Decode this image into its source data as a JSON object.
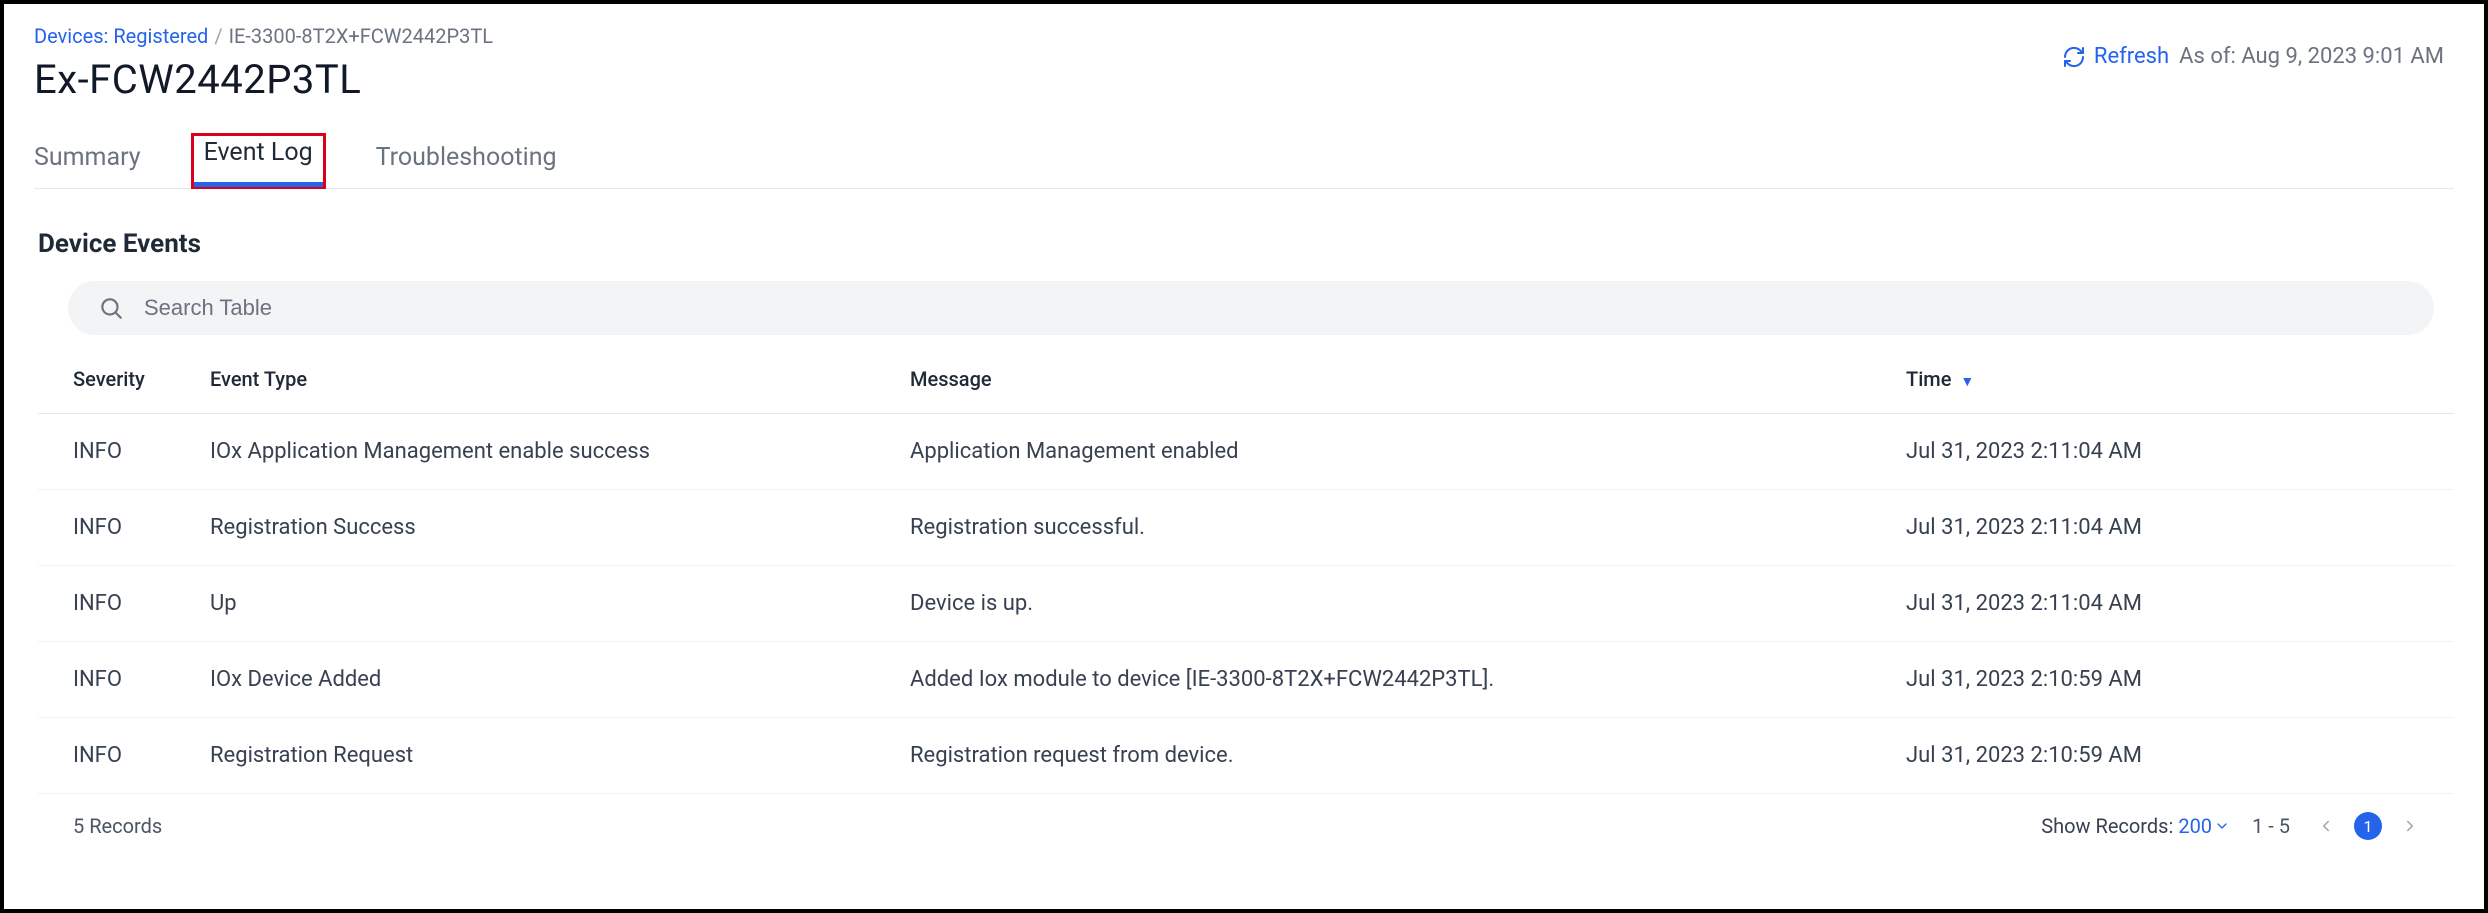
{
  "breadcrumb": {
    "link_text": "Devices: Registered",
    "separator": "/",
    "current": "IE-3300-8T2X+FCW2442P3TL"
  },
  "page_title": "Ex-FCW2442P3TL",
  "refresh": {
    "label": "Refresh",
    "asof_prefix": "As of:",
    "asof_value": "Aug 9, 2023 9:01 AM"
  },
  "tabs": [
    {
      "label": "Summary",
      "active": false
    },
    {
      "label": "Event Log",
      "active": true
    },
    {
      "label": "Troubleshooting",
      "active": false
    }
  ],
  "section_title": "Device Events",
  "search": {
    "placeholder": "Search Table"
  },
  "columns": {
    "severity": "Severity",
    "event_type": "Event Type",
    "message": "Message",
    "time": "Time"
  },
  "rows": [
    {
      "severity": "INFO",
      "event_type": "IOx Application Management enable success",
      "message": "Application Management enabled",
      "time": "Jul 31, 2023 2:11:04 AM"
    },
    {
      "severity": "INFO",
      "event_type": "Registration Success",
      "message": "Registration successful.",
      "time": "Jul 31, 2023 2:11:04 AM"
    },
    {
      "severity": "INFO",
      "event_type": "Up",
      "message": "Device is up.",
      "time": "Jul 31, 2023 2:11:04 AM"
    },
    {
      "severity": "INFO",
      "event_type": "IOx Device Added",
      "message": "Added Iox module to device [IE-3300-8T2X+FCW2442P3TL].",
      "time": "Jul 31, 2023 2:10:59 AM"
    },
    {
      "severity": "INFO",
      "event_type": "Registration Request",
      "message": "Registration request from device.",
      "time": "Jul 31, 2023 2:10:59 AM"
    }
  ],
  "footer": {
    "records_text": "5 Records",
    "show_records_label": "Show Records:",
    "show_records_value": "200",
    "range": "1 - 5",
    "current_page": "1"
  }
}
